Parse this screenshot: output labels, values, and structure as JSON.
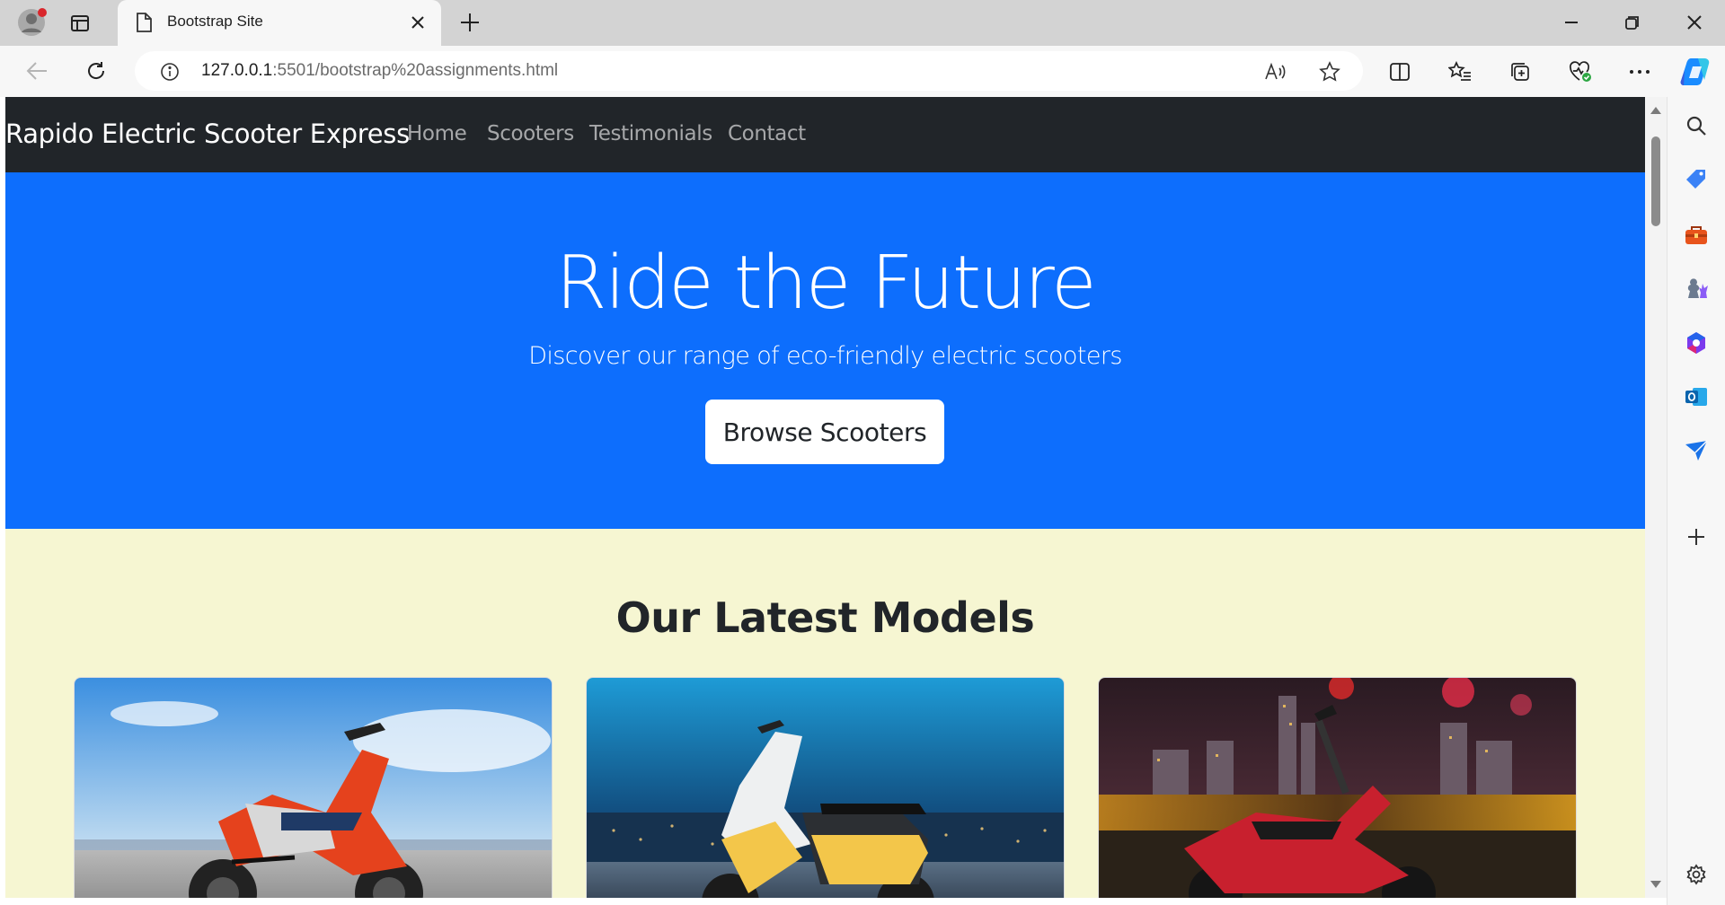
{
  "browser": {
    "tab_title": "Bootstrap Site",
    "url_host": "127.0.0.1",
    "url_rest": ":5501/bootstrap%20assignments.html"
  },
  "navbar": {
    "brand": "Rapido Electric Scooter Express",
    "links": [
      "Home",
      "Scooters",
      "Testimonials",
      "Contact"
    ]
  },
  "hero": {
    "title": "Ride the Future",
    "subtitle": "Discover our range of eco-friendly electric scooters",
    "button": "Browse Scooters"
  },
  "models": {
    "title": "Our Latest Models",
    "cards": [
      {
        "image": "red-scooter-sky-image"
      },
      {
        "image": "yellow-scooter-city-image"
      },
      {
        "image": "red-scooter-night-image"
      }
    ]
  },
  "colors": {
    "navbar": "#212529",
    "hero": "#0d6efd",
    "section_bg": "#f6f6d2"
  }
}
